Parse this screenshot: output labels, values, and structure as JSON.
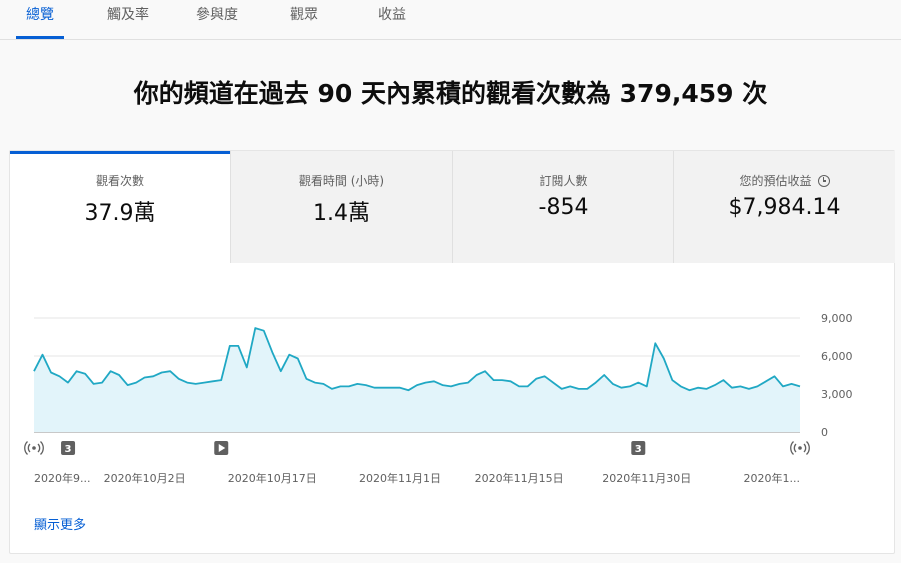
{
  "tabs": [
    {
      "label": "總覽",
      "active": true
    },
    {
      "label": "觸及率",
      "active": false
    },
    {
      "label": "參與度",
      "active": false
    },
    {
      "label": "觀眾",
      "active": false
    },
    {
      "label": "收益",
      "active": false
    }
  ],
  "headline": "你的頻道在過去 90 天內累積的觀看次數為 379,459 次",
  "metrics": [
    {
      "label": "觀看次數",
      "value": "37.9萬",
      "active": true
    },
    {
      "label": "觀看時間 (小時)",
      "value": "1.4萬",
      "active": false
    },
    {
      "label": "訂閱人數",
      "value": "-854",
      "active": false
    },
    {
      "label": "您的預估收益",
      "value": "$7,984.14",
      "active": false,
      "icon": "clock-icon"
    }
  ],
  "colors": {
    "accent": "#065fd4",
    "line": "#20a8c4",
    "fill": "#e2f4fa",
    "marker": "#606060"
  },
  "chart_data": {
    "type": "area",
    "ylim": [
      0,
      9000
    ],
    "y_ticks": [
      "0",
      "3,000",
      "6,000",
      "9,000"
    ],
    "x_tick_labels": [
      "2020年9...",
      "2020年10月2日",
      "2020年10月17日",
      "2020年11月1日",
      "2020年11月15日",
      "2020年11月30日",
      "2020年1..."
    ],
    "x_tick_days": [
      0,
      13,
      28,
      43,
      57,
      72,
      85
    ],
    "values": [
      4800,
      6100,
      4700,
      4400,
      3900,
      4800,
      4600,
      3800,
      3900,
      4800,
      4500,
      3700,
      3900,
      4300,
      4400,
      4700,
      4800,
      4200,
      3900,
      3800,
      3900,
      4000,
      4100,
      6800,
      6800,
      5100,
      8200,
      8000,
      6300,
      4800,
      6100,
      5800,
      4200,
      3900,
      3800,
      3400,
      3600,
      3600,
      3800,
      3700,
      3500,
      3500,
      3500,
      3500,
      3300,
      3700,
      3900,
      4000,
      3700,
      3600,
      3800,
      3900,
      4500,
      4800,
      4100,
      4100,
      4000,
      3600,
      3600,
      4200,
      4400,
      3900,
      3400,
      3600,
      3400,
      3400,
      3900,
      4500,
      3800,
      3500,
      3600,
      3900,
      3600,
      7000,
      5800,
      4100,
      3600,
      3300,
      3500,
      3400,
      3700,
      4100,
      3500,
      3600,
      3400,
      3600,
      4000,
      4400,
      3600,
      3800,
      3600
    ],
    "markers": [
      {
        "type": "broadcast",
        "day": 0
      },
      {
        "type": "badge",
        "label": "3",
        "day": 4
      },
      {
        "type": "play",
        "day": 22
      },
      {
        "type": "badge",
        "label": "3",
        "day": 71
      },
      {
        "type": "broadcast",
        "day": 90
      }
    ]
  },
  "show_more": "顯示更多"
}
